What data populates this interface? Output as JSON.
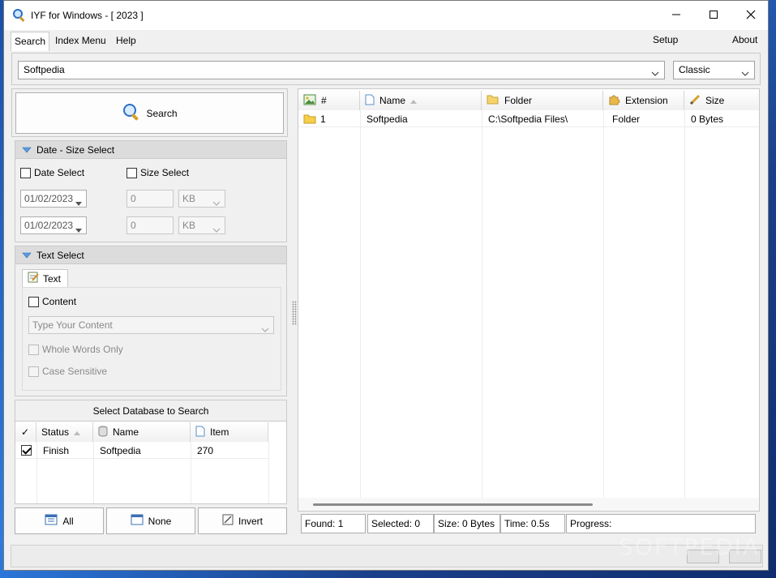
{
  "window": {
    "title": "IYF for Windows - [ 2023 ]"
  },
  "menu": {
    "tabs": [
      {
        "label": "Search"
      },
      {
        "label": "Index Menu"
      },
      {
        "label": "Help"
      }
    ],
    "right": [
      {
        "label": "Setup"
      },
      {
        "label": "About"
      }
    ]
  },
  "search": {
    "query": "Softpedia",
    "mode": "Classic",
    "button_label": "Search"
  },
  "date_size": {
    "header": "Date - Size Select",
    "date_select_label": "Date Select",
    "size_select_label": "Size Select",
    "date_from": "01/02/2023",
    "date_to": "01/02/2023",
    "size_from": "0",
    "size_to": "0",
    "unit_from": "KB",
    "unit_to": "KB"
  },
  "text_select": {
    "header": "Text Select",
    "tab_label": "Text",
    "content_label": "Content",
    "content_placeholder": "Type Your Content",
    "whole_words_label": "Whole Words Only",
    "case_sensitive_label": "Case Sensitive"
  },
  "database": {
    "header": "Select Database to Search",
    "columns": {
      "check": "✓",
      "status": "Status",
      "name": "Name",
      "item": "Item"
    },
    "rows": [
      {
        "checked": true,
        "status": "Finish",
        "name": "Softpedia",
        "item": "270"
      }
    ],
    "buttons": {
      "all": "All",
      "none": "None",
      "invert": "Invert"
    }
  },
  "results": {
    "columns": {
      "num": "#",
      "name": "Name",
      "folder": "Folder",
      "extension": "Extension",
      "size": "Size"
    },
    "rows": [
      {
        "num": "1",
        "name": "Softpedia",
        "folder": "C:\\Softpedia Files\\",
        "extension": "Folder",
        "size": "0 Bytes"
      }
    ]
  },
  "status": {
    "found": "Found: 1",
    "selected": "Selected: 0",
    "size": "Size: 0 Bytes",
    "time": "Time: 0.5s",
    "progress": "Progress:"
  },
  "watermark": "SOFTPEDIA"
}
